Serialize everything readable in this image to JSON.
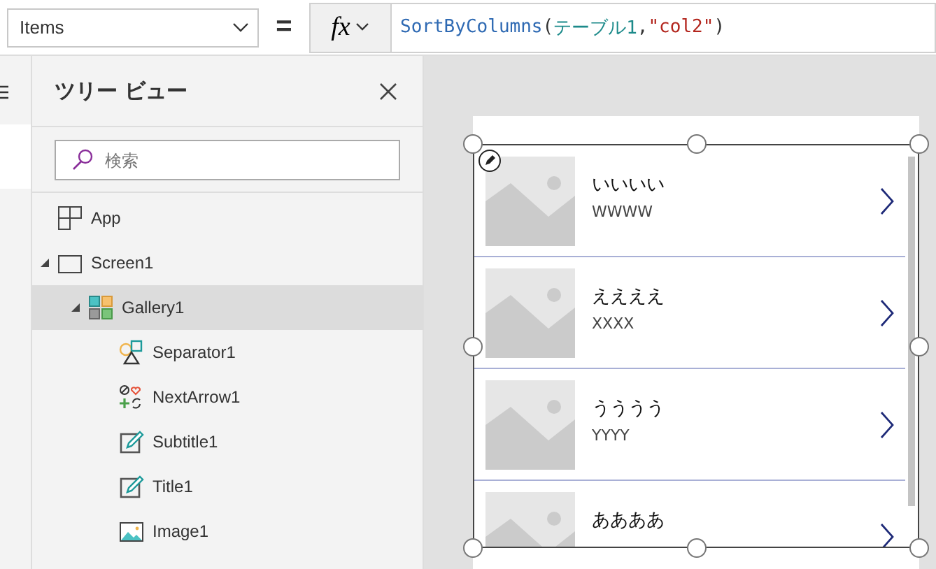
{
  "formula_bar": {
    "property": "Items",
    "equals": "=",
    "fx": "fx",
    "formula": [
      {
        "kind": "function",
        "text": "SortByColumns"
      },
      {
        "kind": "punct",
        "text": "("
      },
      {
        "kind": "name",
        "text": "テーブル1"
      },
      {
        "kind": "punct",
        "text": ","
      },
      {
        "kind": "string",
        "text": "\"col2\""
      },
      {
        "kind": "punct",
        "text": ")"
      }
    ]
  },
  "tree_view": {
    "title": "ツリー ビュー",
    "search": {
      "placeholder": "検索"
    },
    "items": [
      {
        "label": "App",
        "kind": "app",
        "selected": false
      },
      {
        "label": "Screen1",
        "kind": "screen",
        "selected": false,
        "expanded": true,
        "children": [
          {
            "label": "Gallery1",
            "kind": "gallery",
            "selected": true,
            "expanded": true,
            "children": [
              {
                "label": "Separator1",
                "kind": "shapes",
                "selected": false
              },
              {
                "label": "NextArrow1",
                "kind": "icons",
                "selected": false
              },
              {
                "label": "Subtitle1",
                "kind": "label",
                "selected": false
              },
              {
                "label": "Title1",
                "kind": "label",
                "selected": false
              },
              {
                "label": "Image1",
                "kind": "image",
                "selected": false
              }
            ]
          }
        ]
      }
    ]
  },
  "gallery": {
    "selected": true,
    "items": [
      {
        "title": "いいいい",
        "subtitle": "WWWW"
      },
      {
        "title": "ええええ",
        "subtitle": "XXXX"
      },
      {
        "title": "うううう",
        "subtitle": "YYYY"
      },
      {
        "title": "ああああ"
      }
    ]
  }
}
